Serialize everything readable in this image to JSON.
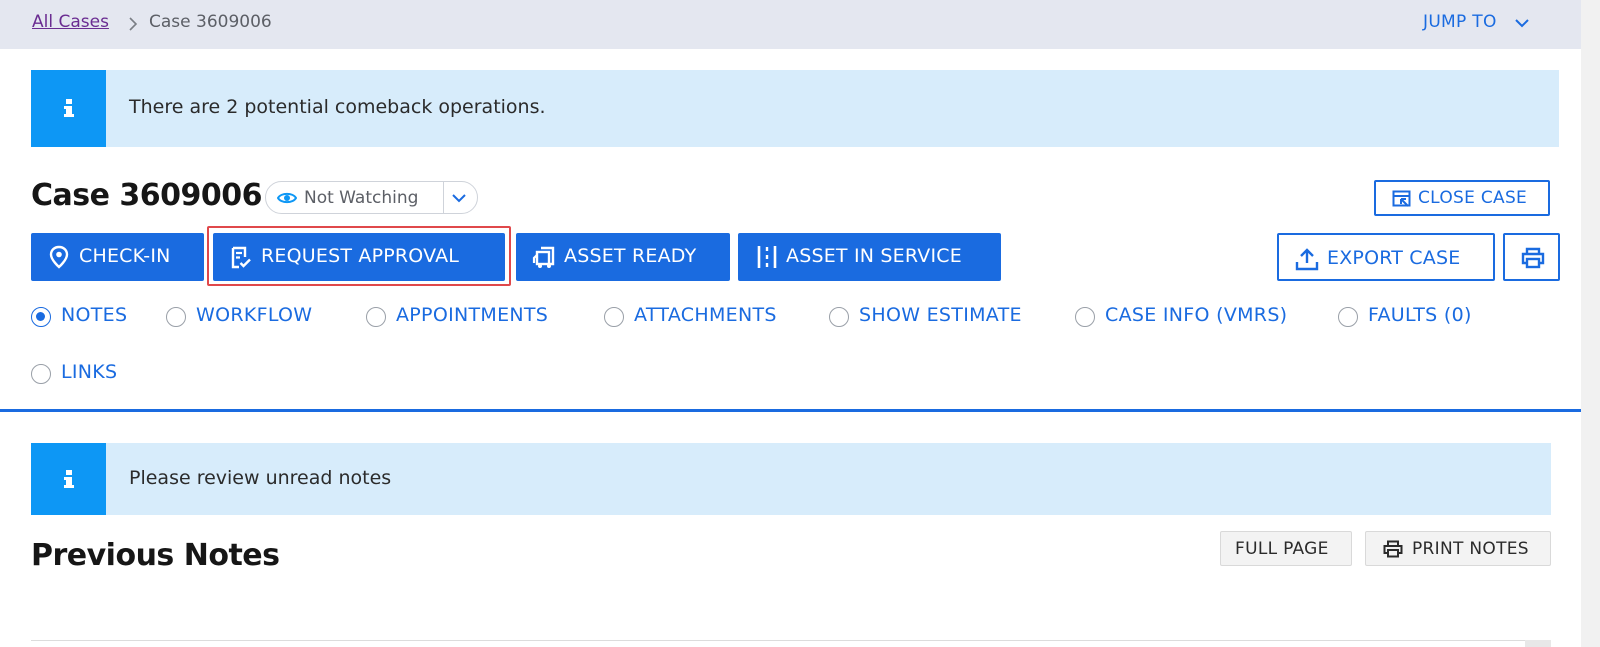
{
  "breadcrumb": {
    "parent": "All Cases",
    "current": "Case 3609006"
  },
  "jump_to": "JUMP TO",
  "alerts": {
    "comeback": "There are 2 potential comeback operations.",
    "unread": "Please review unread notes"
  },
  "case": {
    "title": "Case 3609006",
    "watch_status": "Not Watching",
    "close_label": "CLOSE CASE"
  },
  "actions": {
    "check_in": "CHECK-IN",
    "request_approval": "REQUEST APPROVAL",
    "asset_ready": "ASSET READY",
    "asset_in_service": "ASSET IN SERVICE",
    "export_case": "EXPORT CASE"
  },
  "tabs": [
    {
      "label": "NOTES",
      "selected": true
    },
    {
      "label": "WORKFLOW",
      "selected": false
    },
    {
      "label": "APPOINTMENTS",
      "selected": false
    },
    {
      "label": "ATTACHMENTS",
      "selected": false
    },
    {
      "label": "SHOW ESTIMATE",
      "selected": false
    },
    {
      "label": "CASE INFO (VMRS)",
      "selected": false
    },
    {
      "label": "FAULTS (0)",
      "selected": false
    },
    {
      "label": "LINKS",
      "selected": false
    }
  ],
  "notes": {
    "title": "Previous Notes",
    "full_page": "FULL PAGE",
    "print_notes": "PRINT NOTES"
  },
  "icons": {
    "breadcrumb_separator": "chevron-right-icon",
    "jump": "chevron-down-icon",
    "info": "info-icon",
    "watch": "eye-icon",
    "close_case": "close-case-icon",
    "check_in": "map-pin-icon",
    "request_approval": "clipboard-check-icon",
    "asset_ready": "asset-ready-icon",
    "asset_in_service": "asset-in-service-icon",
    "export": "upload-icon",
    "print": "printer-icon"
  },
  "colors": {
    "primary": "#1a6be0",
    "info_icon_bg": "#0d97f5",
    "info_bg": "#d7ecfb",
    "topbar_bg": "#e4e7f0",
    "visited_link": "#6a2c91",
    "highlight": "#e0484b"
  }
}
